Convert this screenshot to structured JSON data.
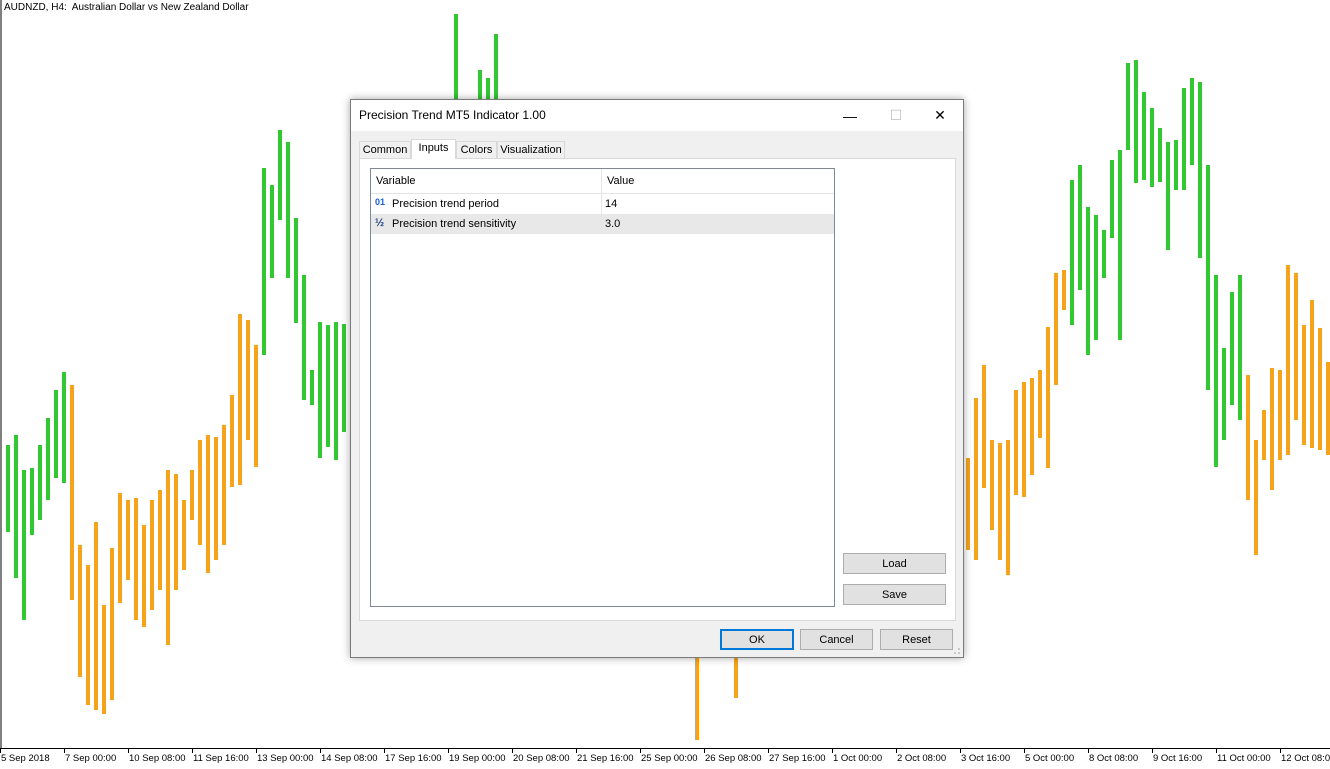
{
  "chart": {
    "title": "AUDNZD, H4:  Australian Dollar vs New Zealand Dollar",
    "up_color": "#32c832",
    "down_color": "#f5a31a",
    "x_labels": [
      "5 Sep 2018",
      "7 Sep 00:00",
      "10 Sep 08:00",
      "11 Sep 16:00",
      "13 Sep 00:00",
      "14 Sep 08:00",
      "17 Sep 16:00",
      "19 Sep 00:00",
      "20 Sep 08:00",
      "21 Sep 16:00",
      "25 Sep 00:00",
      "26 Sep 08:00",
      "27 Sep 16:00",
      "1 Oct 00:00",
      "2 Oct 08:00",
      "3 Oct 16:00",
      "5 Oct 00:00",
      "8 Oct 08:00",
      "9 Oct 16:00",
      "11 Oct 00:00",
      "12 Oct 08:00"
    ]
  },
  "dialog": {
    "title": "Precision Trend MT5 Indicator 1.00",
    "minimize_icon": "—",
    "maximize_icon": "☐",
    "close_icon": "✕",
    "tabs": [
      {
        "label": "Common"
      },
      {
        "label": "Inputs"
      },
      {
        "label": "Colors"
      },
      {
        "label": "Visualization"
      }
    ],
    "active_tab": "Inputs",
    "grid": {
      "col_variable": "Variable",
      "col_value": "Value",
      "rows": [
        {
          "icon": "01",
          "variable": "Precision trend period",
          "value": "14"
        },
        {
          "icon": "½",
          "variable": "Precision trend sensitivity",
          "value": "3.0"
        }
      ]
    },
    "load_label": "Load",
    "save_label": "Save",
    "ok_label": "OK",
    "cancel_label": "Cancel",
    "reset_label": "Reset"
  }
}
